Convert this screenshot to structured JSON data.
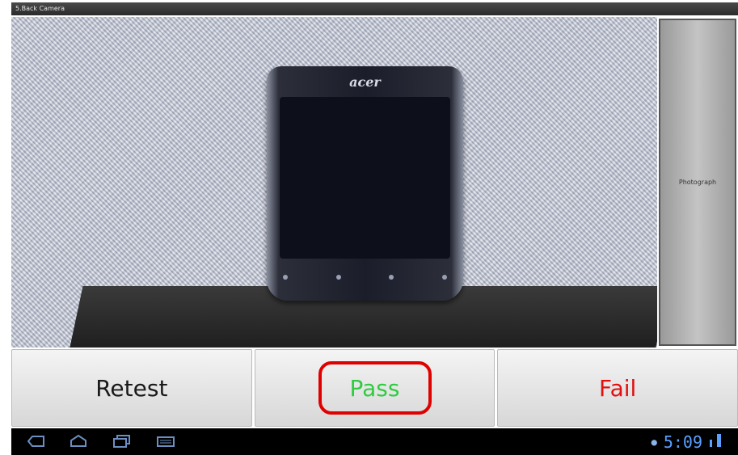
{
  "window": {
    "title": "5.Back Camera"
  },
  "camera": {
    "photograph_label": "Photograph"
  },
  "actions": {
    "retest_label": "Retest",
    "pass_label": "Pass",
    "fail_label": "Fail"
  },
  "navbar": {
    "icons": [
      "back-icon",
      "home-icon",
      "recent-apps-icon",
      "keyboard-icon"
    ],
    "clock": "5:09"
  },
  "colors": {
    "pass": "#2ecc40",
    "fail": "#e01010",
    "highlight_circle": "#e00000",
    "status_blue": "#5aa0ff"
  },
  "scene": {
    "phone_brand": "acer"
  }
}
